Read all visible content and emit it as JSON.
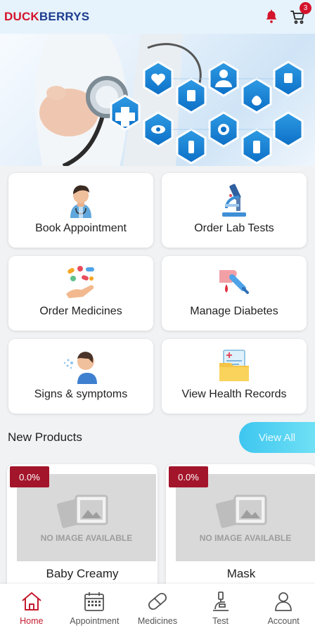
{
  "header": {
    "brand_part1": "DUCK",
    "brand_part2": "BERRYS",
    "cart_count": "3"
  },
  "services": [
    {
      "label": "Book Appointment",
      "icon": "doctor-icon"
    },
    {
      "label": "Order Lab Tests",
      "icon": "microscope-icon"
    },
    {
      "label": "Order Medicines",
      "icon": "pills-hand-icon"
    },
    {
      "label": "Manage Diabetes",
      "icon": "glucose-meter-icon"
    },
    {
      "label": "Signs & symptoms",
      "icon": "sneezing-person-icon"
    },
    {
      "label": "View Health Records",
      "icon": "health-records-folder-icon"
    }
  ],
  "new_products": {
    "title": "New Products",
    "view_all_label": "View All",
    "no_image_text": "NO IMAGE AVAILABLE",
    "items": [
      {
        "name": "Baby Creamy",
        "discount": "0.0%"
      },
      {
        "name": "Mask",
        "discount": "0.0%"
      }
    ]
  },
  "bottom_nav": [
    {
      "label": "Home",
      "icon": "home-icon",
      "active": true
    },
    {
      "label": "Appointment",
      "icon": "calendar-icon",
      "active": false
    },
    {
      "label": "Medicines",
      "icon": "pill-icon",
      "active": false
    },
    {
      "label": "Test",
      "icon": "microscope-icon",
      "active": false
    },
    {
      "label": "Account",
      "icon": "user-icon",
      "active": false
    }
  ],
  "colors": {
    "brand_red": "#d4142c",
    "brand_blue": "#1e3c8f",
    "accent_cyan": "#3ec6f0",
    "discount_red": "#a3152a",
    "active_nav": "#c41b2e"
  }
}
